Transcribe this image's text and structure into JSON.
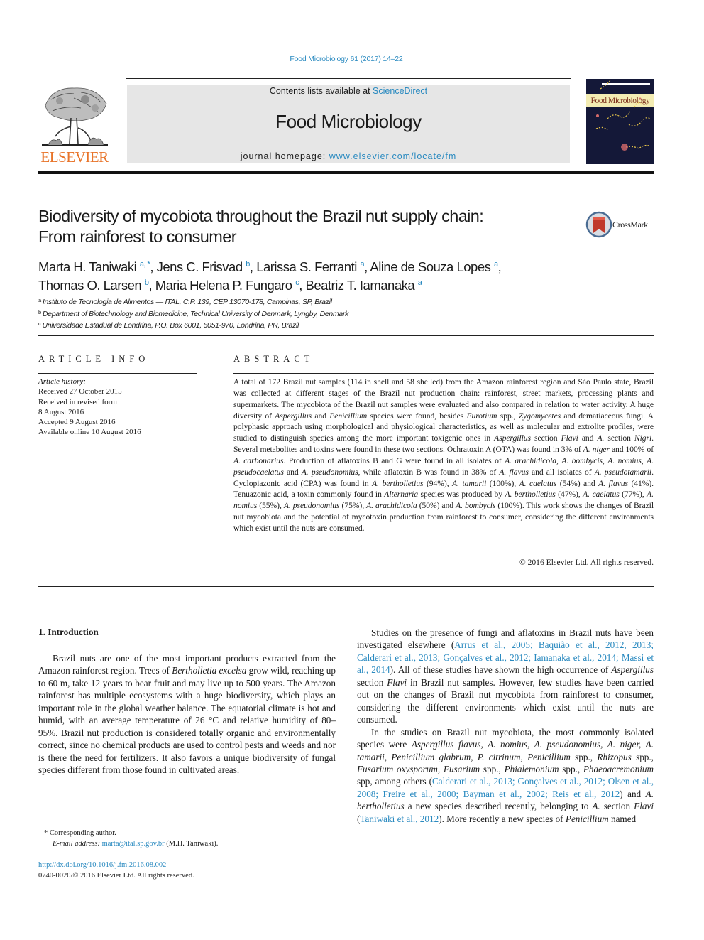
{
  "header": {
    "running_head": "Food Microbiology 61 (2017) 14–22",
    "contents_prefix": "Contents lists available at ",
    "contents_link": "ScienceDirect",
    "journal_title": "Food Microbiology",
    "homepage_prefix": "journal homepage: ",
    "homepage_link": "www.elsevier.com/locate/fm",
    "publisher_logo_text": "ELSEVIER",
    "cover_title": "Food Microbiology",
    "crossmark_label": "CrossMark",
    "colors": {
      "link": "#2a8ac0",
      "elsevier_orange": "#e8742a",
      "masthead_bg": "#e6e6e6",
      "crossmark_red": "#c0392b"
    }
  },
  "article": {
    "title_line1": "Biodiversity of mycobiota throughout the Brazil nut supply chain:",
    "title_line2": "From rainforest to consumer",
    "authors": [
      {
        "name": "Marta H. Taniwaki",
        "sup": "a, *",
        "sep": ", "
      },
      {
        "name": "Jens C. Frisvad",
        "sup": "b",
        "sep": ", "
      },
      {
        "name": "Larissa S. Ferranti",
        "sup": "a",
        "sep": ", "
      },
      {
        "name": "Aline de Souza Lopes",
        "sup": "a",
        "sep": ","
      },
      {
        "name": "Thomas O. Larsen",
        "sup": "b",
        "sep": ", "
      },
      {
        "name": "Maria Helena P. Fungaro",
        "sup": "c",
        "sep": ", "
      },
      {
        "name": "Beatriz T. Iamanaka",
        "sup": "a",
        "sep": ""
      }
    ],
    "affiliations": [
      {
        "key": "a",
        "text": "Instituto de Tecnologia de Alimentos — ITAL, C.P. 139, CEP 13070-178, Campinas, SP, Brazil"
      },
      {
        "key": "b",
        "text": "Department of Biotechnology and Biomedicine, Technical University of Denmark, Lyngby, Denmark"
      },
      {
        "key": "c",
        "text": "Universidade Estadual de Londrina, P.O. Box 6001, 6051-970, Londrina, PR, Brazil"
      }
    ]
  },
  "article_info": {
    "heading": "ARTICLE INFO",
    "history_label": "Article history:",
    "history": [
      "Received 27 October 2015",
      "Received in revised form",
      "8 August 2016",
      "Accepted 9 August 2016",
      "Available online 10 August 2016"
    ]
  },
  "abstract": {
    "heading": "ABSTRACT",
    "s01": "A total of 172 Brazil nut samples (114 in shell and 58 shelled) from the Amazon rainforest region and São Paulo state, Brazil was collected at different stages of the Brazil nut production chain: rainforest, street markets, processing plants and supermarkets. The mycobiota of the Brazil nut samples were evaluated and also compared in relation to water activity. A huge diversity of ",
    "i01": "Aspergillus",
    "s02": " and ",
    "i02": "Penicillium",
    "s03": " species were found, besides ",
    "i03": "Eurotium",
    "s04": " spp., ",
    "i04": "Zygomycetes",
    "s05": " and dematiaceous fungi. A polyphasic approach using morphological and physiological characteristics, as well as molecular and extrolite profiles, were studied to distinguish species among the more important toxigenic ones in ",
    "i05": "Aspergillus",
    "s06": " section ",
    "i06": "Flavi",
    "s07": " and ",
    "i07": "A.",
    "s08": " section ",
    "i08": "Nigri",
    "s09": ". Several metabolites and toxins were found in these two sections. Ochratoxin A (OTA) was found in 3% of ",
    "i09": "A. niger",
    "s10": " and 100% of ",
    "i10": "A. carbonarius",
    "s11": ". Production of aflatoxins B and G were found in all isolates of ",
    "i11": "A. arachidicola",
    "s12": ", ",
    "i12": "A. bombycis",
    "s13": ", ",
    "i13": "A. nomius",
    "s14": ", ",
    "i14": "A. pseudocaelatus",
    "s15": " and ",
    "i15": "A. pseudonomius",
    "s16": ", while aflatoxin B was found in 38% of ",
    "i16": "A. flavus",
    "s17": " and all isolates of ",
    "i17": "A. pseudotamarii",
    "s18": ". Cyclopiazonic acid (CPA) was found in ",
    "i18": "A. bertholletius",
    "s19": " (94%), ",
    "i19": "A. tamarii",
    "s20": " (100%), ",
    "i20": "A. caelatus",
    "s21": " (54%) and ",
    "i21": "A. flavus",
    "s22": " (41%). Tenuazonic acid, a toxin commonly found in ",
    "i22": "Alternaria",
    "s23": " species was produced by ",
    "i23": "A. bertholletius",
    "s24": " (47%), ",
    "i24": "A. caelatus",
    "s25": " (77%), ",
    "i25": "A. nomius",
    "s26": " (55%), ",
    "i26": "A. pseudonomius",
    "s27": " (75%), ",
    "i27": "A. arachidicola",
    "s28": " (50%) and ",
    "i28": "A. bombycis",
    "s29": " (100%). This work shows the changes of Brazil nut mycobiota and the potential of mycotoxin production from rainforest to consumer, considering the different environments which exist until the nuts are consumed.",
    "copyright": "© 2016 Elsevier Ltd. All rights reserved."
  },
  "body": {
    "intro_heading": "1.  Introduction",
    "p1": {
      "a": "Brazil nuts are one of the most important products extracted from the Amazon rainforest region. Trees of ",
      "i1": "Bertholletia excelsa",
      "b": " grow wild, reaching up to 60 m, take 12 years to bear fruit and may live up to 500 years. The Amazon rainforest has multiple ecosystems with a huge biodiversity, which plays an important role in the global weather balance. The equatorial climate is hot and humid, with an average temperature of 26 °C and relative humidity of 80–95%. Brazil nut production is considered totally organic and environmentally correct, since no chemical products are used to control pests and weeds and nor is there the need for fertilizers. It also favors a unique biodiversity of fungal species different from those found in cultivated areas."
    },
    "p2": {
      "a": "Studies on the presence of fungi and aflatoxins in Brazil nuts have been investigated elsewhere (",
      "ref1": "Arrus et al., 2005; Baquião et al., 2012, 2013; Calderari et al., 2013; Gonçalves et al., 2012; Iamanaka et al., 2014; Massi et al., 2014",
      "b": "). All of these studies have shown the high occurrence of ",
      "i1": "Aspergillus",
      "c": " section ",
      "i2": "Flavi",
      "d": " in Brazil nut samples. However, few studies have been carried out on the changes of Brazil nut mycobiota from rainforest to consumer, considering the different environments which exist until the nuts are consumed."
    },
    "p3": {
      "a": "In the studies on Brazil nut mycobiota, the most commonly isolated species were ",
      "i1": "Aspergillus flavus, A. nomius, A. pseudonomius, A. niger, A. tamarii, Penicillium glabrum, P. citrinum, Penicillium",
      "b": " spp., ",
      "i2": "Rhizopus",
      "c": " spp., ",
      "i3": "Fusarium oxysporum, Fusarium",
      "d": " spp., ",
      "i4": "Phialemonium",
      "e": " spp., ",
      "i5": "Phaeoacremonium",
      "f": " spp, among others (",
      "ref1": "Calderari et al., 2013; Gonçalves et al., 2012; Olsen et al., 2008; Freire et al., 2000; Bayman et al., 2002; Reis et al., 2012",
      "g": ") and ",
      "i6": "A. bertholletius",
      "h": " a new species described recently, belonging to ",
      "i7": "A.",
      "j": " section ",
      "i8": "Flavi",
      "k": " (",
      "ref2": "Taniwaki et al., 2012",
      "l": "). More recently a new species of ",
      "i9": "Penicillium",
      "m": " named"
    }
  },
  "footnotes": {
    "corresponding_mark": "*",
    "corresponding_text": " Corresponding author.",
    "email_label": "E-mail address: ",
    "email": "marta@ital.sp.gov.br",
    "email_suffix": " (M.H. Taniwaki).",
    "doi": "http://dx.doi.org/10.1016/j.fm.2016.08.002",
    "issn_line": "0740-0020/© 2016 Elsevier Ltd. All rights reserved."
  }
}
